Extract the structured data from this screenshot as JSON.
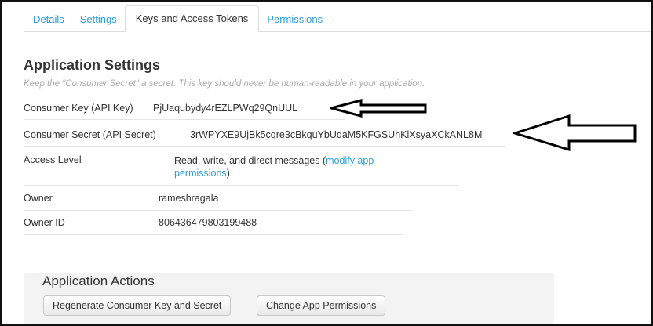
{
  "tabs": [
    {
      "label": "Details",
      "active": false
    },
    {
      "label": "Settings",
      "active": false
    },
    {
      "label": "Keys and Access Tokens",
      "active": true
    },
    {
      "label": "Permissions",
      "active": false
    }
  ],
  "app_settings": {
    "title": "Application Settings",
    "subtitle": "Keep the \"Consumer Secret\" a secret. This key should never be human-readable in your application.",
    "rows": [
      {
        "label": "Consumer Key (API Key)",
        "value": "PjUaqubydy4rEZLPWq29QnUUL"
      },
      {
        "label": "Consumer Secret (API Secret)",
        "value": "3rWPYXE9UjBk5cqre3cBkquYbUdaM5KFGSUhKlXsyaXCkANL8M"
      },
      {
        "label": "Access Level",
        "value": "Read, write, and direct messages (",
        "link": "modify app permissions",
        "suffix": ")"
      },
      {
        "label": "Owner",
        "value": "rameshragala"
      },
      {
        "label": "Owner ID",
        "value": "806436479803199488"
      }
    ]
  },
  "actions": {
    "title": "Application Actions",
    "regenerate_label": "Regenerate Consumer Key and Secret",
    "change_permissions_label": "Change App Permissions"
  },
  "annotation_color": "#000000"
}
